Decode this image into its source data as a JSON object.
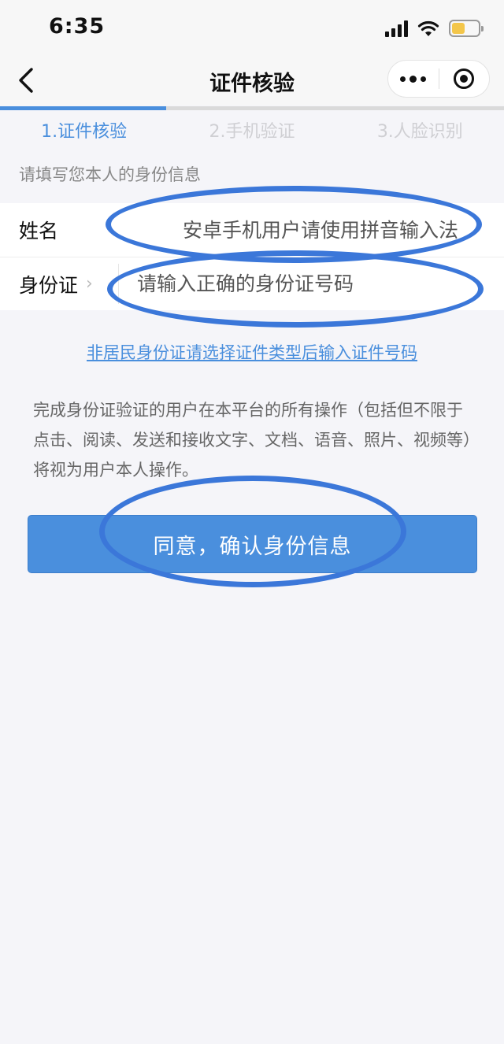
{
  "status_bar": {
    "time": "6:35"
  },
  "nav": {
    "title": "证件核验"
  },
  "progress": {
    "fraction": 0.33
  },
  "steps": [
    {
      "label": "1.证件核验",
      "active": true
    },
    {
      "label": "2.手机验证",
      "active": false
    },
    {
      "label": "3.人脸识别",
      "active": false
    }
  ],
  "form": {
    "hint": "请填写您本人的身份信息",
    "name_label": "姓名",
    "name_placeholder": "安卓手机用户请使用拼音输入法",
    "id_label": "身份证",
    "id_chevron": "›",
    "id_placeholder": "请输入正确的身份证号码"
  },
  "link_text": "非居民身份证请选择证件类型后输入证件号码",
  "notice": "完成身份证验证的用户在本平台的所有操作（包括但不限于点击、阅读、发送和接收文字、文档、语音、照片、视频等）将视为用户本人操作。",
  "confirm_label": "同意，确认身份信息",
  "colors": {
    "accent": "#4a8fdd",
    "annotation": "#3b77d9"
  },
  "icons": [
    "back-icon",
    "more-icon",
    "close-icon",
    "signal-icon",
    "wifi-icon",
    "battery-icon"
  ]
}
